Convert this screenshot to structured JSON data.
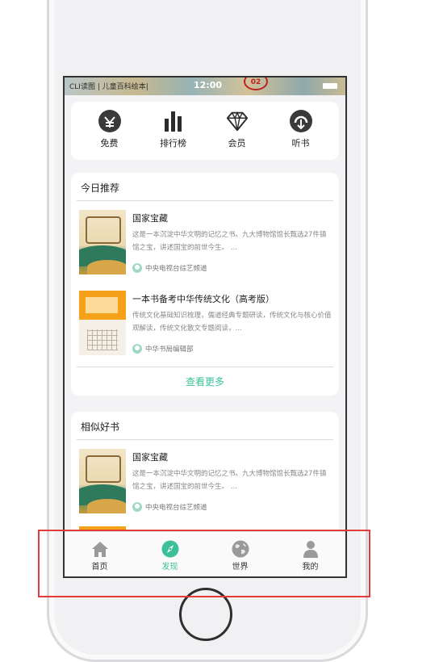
{
  "status_bar": {
    "carrier": "CLI读图 | 儿童百科绘本|",
    "time": "12:00",
    "badge": "02"
  },
  "categories": [
    {
      "label": "免费",
      "icon": "free-icon"
    },
    {
      "label": "排行榜",
      "icon": "ranking-icon"
    },
    {
      "label": "会员",
      "icon": "diamond-icon"
    },
    {
      "label": "听书",
      "icon": "listen-icon"
    }
  ],
  "today_section": {
    "title": "今日推荐",
    "books": [
      {
        "title": "国家宝藏",
        "desc": "这是一本沉淀中华文明的记忆之书。九大博物馆馆长甄选27件镇馆之宝，讲述国宝的前世今生。 …",
        "author": "中央电视台综艺频道"
      },
      {
        "title": "一本书备考中华传统文化（高考版）",
        "desc": "传统文化基础知识梳理，儒道经典专题研读，传统文化与核心价值观解读，传统文化散文专题阅读，…",
        "author": "中华书局编辑部"
      }
    ],
    "more_label": "查看更多"
  },
  "similar_section": {
    "title": "相似好书",
    "books": [
      {
        "title": "国家宝藏",
        "desc": "这是一本沉淀中华文明的记忆之书。九大博物馆馆长甄选27件镇馆之宝，讲述国宝的前世今生。 …",
        "author": "中央电视台综艺频道"
      }
    ]
  },
  "tabbar": [
    {
      "label": "首页",
      "icon": "home-icon",
      "active": false
    },
    {
      "label": "发现",
      "icon": "compass-icon",
      "active": true
    },
    {
      "label": "世界",
      "icon": "globe-icon",
      "active": false
    },
    {
      "label": "我的",
      "icon": "user-icon",
      "active": false
    }
  ],
  "colors": {
    "accent": "#3cc09a",
    "highlight": "#e23b3b",
    "icon_dark": "#2b2b2b"
  }
}
